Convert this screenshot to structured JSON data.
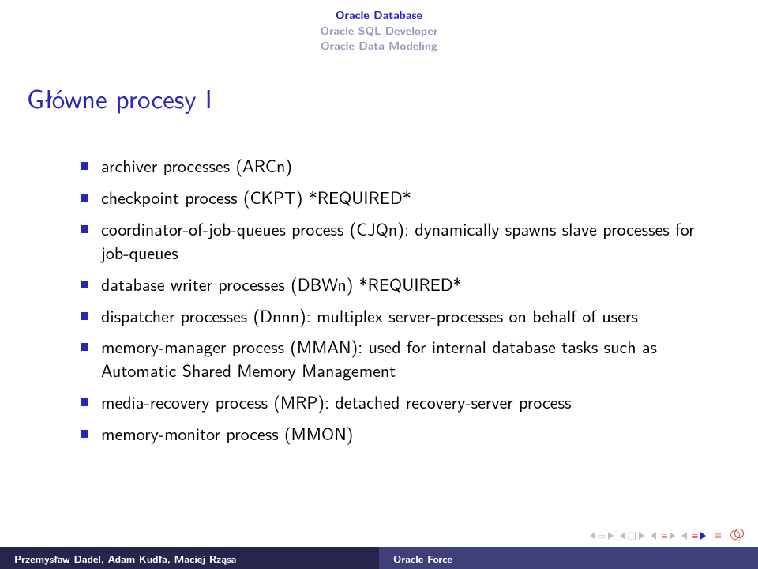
{
  "breadcrumbs": {
    "line1": "Oracle Database",
    "line2": "Oracle SQL Developer",
    "line3": "Oracle Data Modeling"
  },
  "title": "Główne procesy I",
  "bullets": [
    "archiver processes (ARCn)",
    "checkpoint process (CKPT) *REQUIRED*",
    "coordinator-of-job-queues process (CJQn): dynamically spawns slave processes for job-queues",
    "database writer processes (DBWn) *REQUIRED*",
    "dispatcher processes (Dnnn): multiplex server-processes on behalf of users",
    "memory-manager process (MMAN): used for internal database tasks such as Automatic Shared Memory Management",
    "media-recovery process (MRP): detached recovery-server process",
    "memory-monitor process (MMON)"
  ],
  "footer": {
    "authors": "Przemysław Dadel, Adam Kudła, Maciej Rząsa",
    "project": "Oracle Force"
  }
}
